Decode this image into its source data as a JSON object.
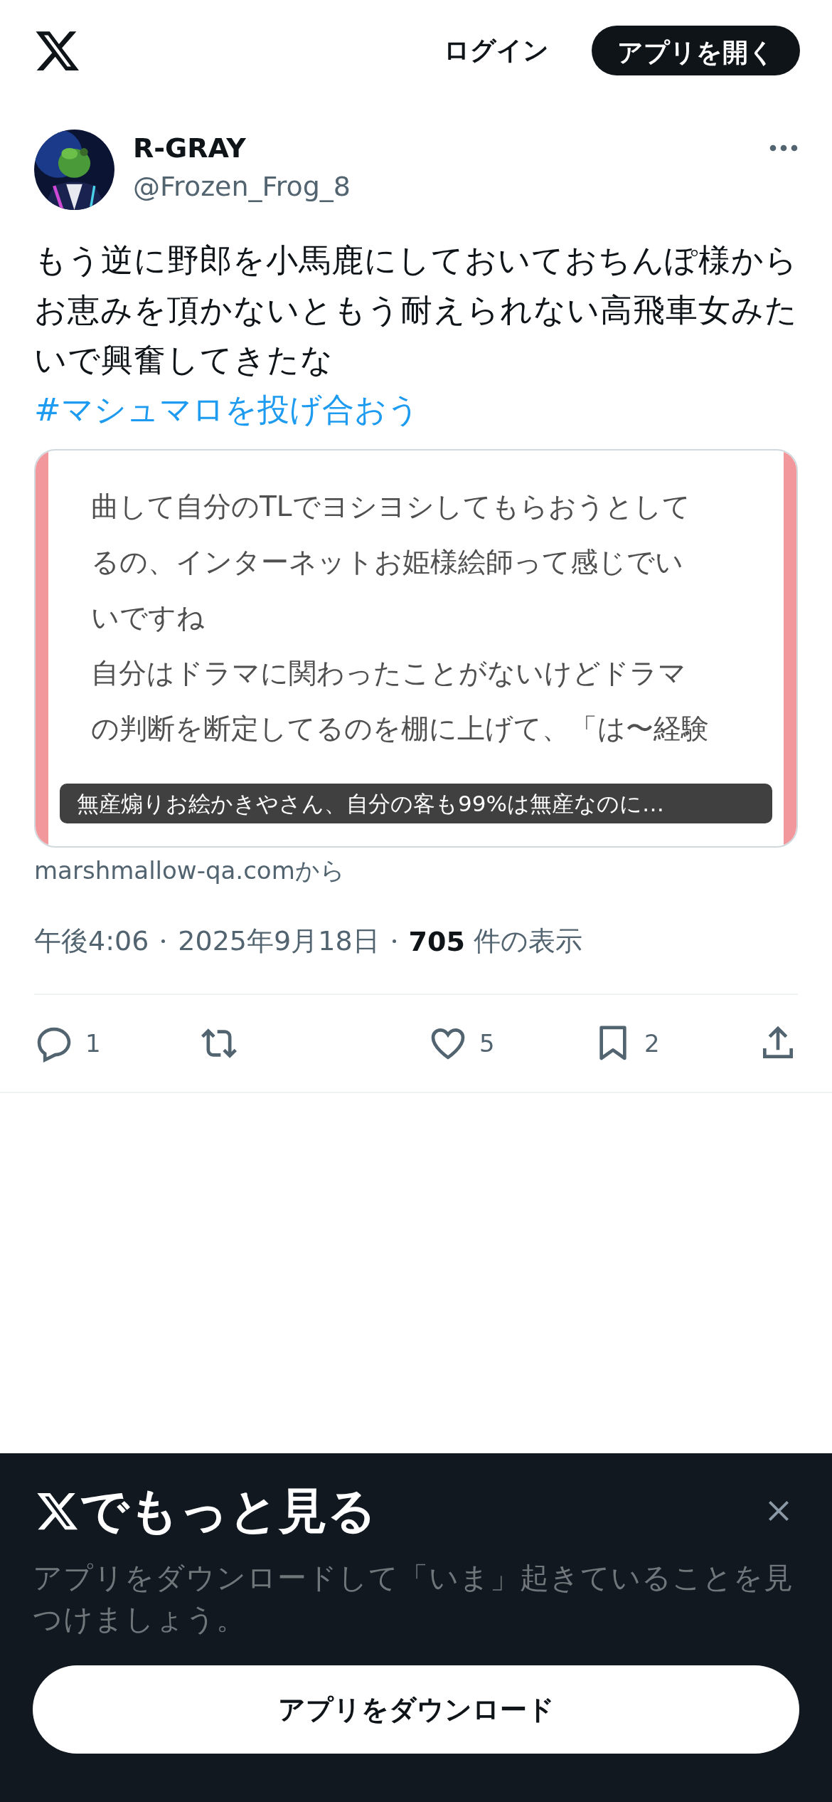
{
  "header": {
    "login": "ログイン",
    "open_app": "アプリを開く"
  },
  "post": {
    "author": {
      "name": "R-GRAY",
      "handle": "@Frozen_Frog_8"
    },
    "text": "もう逆に野郎を小馬鹿にしておいておちんぽ様からお恵みを頂かないともう耐えられない高飛車女みたいで興奮してきたな",
    "hashtag": "#マシュマロを投げ合おう",
    "card": {
      "lines": [
        "曲して自分のTLでヨシヨシしてもらおうとして",
        "るの、インターネットお姫様絵師って感じでい",
        "いですね",
        "自分はドラマに関わったことがないけどドラマ",
        "の判断を断定してるのを棚に上げて、「は〜経験"
      ],
      "caption": "無産煽りお絵かきやさん、自分の客も99%は無産なのに…",
      "source": "marshmallow-qa.comから"
    },
    "time": "午後4:06",
    "date": "2025年9月18日",
    "views": "705",
    "views_label": "件の表示",
    "actions": [
      {
        "kind": "reply",
        "count": "1"
      },
      {
        "kind": "repost"
      },
      {
        "kind": "like",
        "count": "5"
      },
      {
        "kind": "bookmark",
        "count": "2"
      },
      {
        "kind": "share"
      }
    ]
  },
  "banner": {
    "title": "でもっと見る",
    "text": "アプリをダウンロードして「いま」起きていることを見つけましょう。",
    "button": "アプリをダウンロード"
  }
}
